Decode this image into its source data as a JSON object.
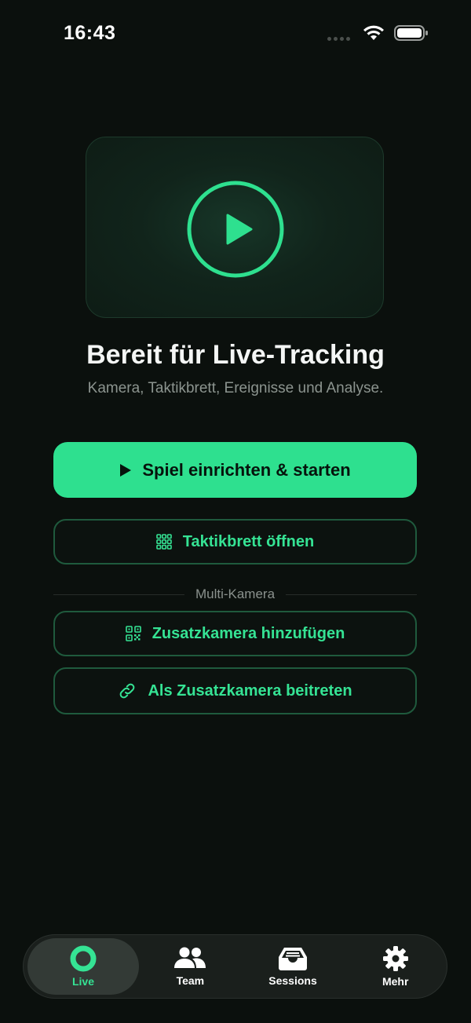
{
  "status_bar": {
    "time": "16:43"
  },
  "hero": {
    "icon": "play-circle-icon",
    "title": "Bereit für Live-Tracking",
    "subtitle": "Kamera, Taktikbrett, Ereignisse und Analyse."
  },
  "actions": {
    "primary_label": "Spiel einrichten & starten",
    "tactics_label": "Taktikbrett öffnen",
    "divider_label": "Multi-Kamera",
    "add_camera_label": "Zusatzkamera hinzufügen",
    "join_camera_label": "Als Zusatzkamera beitreten"
  },
  "tab_bar": {
    "items": [
      {
        "label": "Live",
        "icon": "live-dot-icon",
        "active": true
      },
      {
        "label": "Team",
        "icon": "people-icon",
        "active": false
      },
      {
        "label": "Sessions",
        "icon": "tray-icon",
        "active": false
      },
      {
        "label": "Mehr",
        "icon": "gear-icon",
        "active": false
      }
    ]
  },
  "colors": {
    "background": "#0b100d",
    "accent": "#2ee08f",
    "accent_text": "#35e394",
    "outline_border": "#1f5a3d",
    "tab_bar_bg": "#1a1f1c"
  }
}
